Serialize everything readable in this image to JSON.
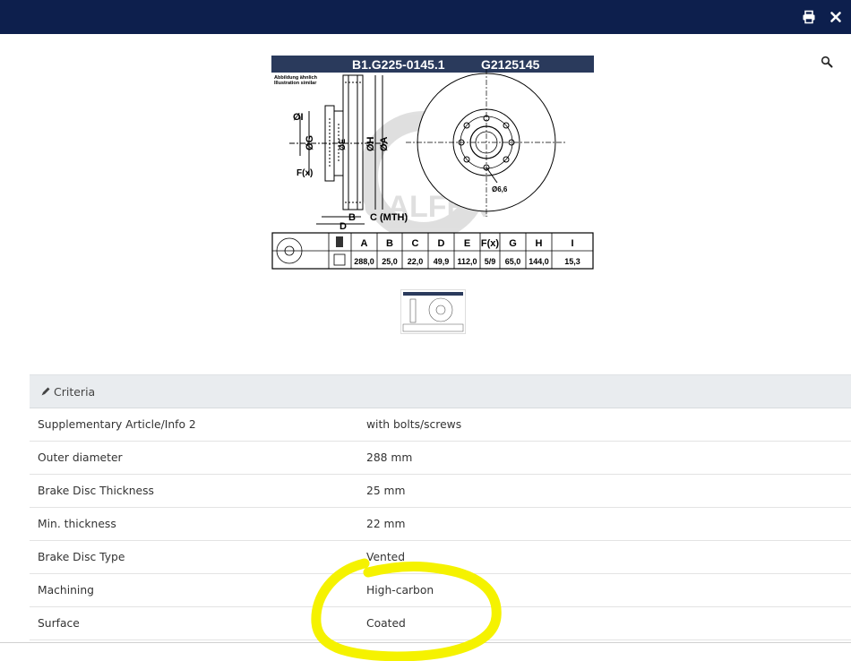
{
  "header": {
    "print_icon": "printer-icon",
    "close_icon": "close-icon",
    "accent": "#0d1f4d"
  },
  "zoom_icon": "magnifier-icon",
  "drawing": {
    "title_left": "B1.G225-0145.1",
    "title_right": "G2125145",
    "note_line1": "Abbildung ähnlich",
    "note_line2": "Illustration similar",
    "mth_label": "C (MTH)",
    "bolt_label": "Ø6,6",
    "dim_labels": {
      "I": "ØI",
      "G": "ØG",
      "E": "ØE",
      "H": "ØH",
      "A": "ØA",
      "F": "F(x)",
      "B": "B",
      "D": "D"
    },
    "table": {
      "headers": [
        "A",
        "B",
        "C",
        "D",
        "E",
        "F(x)",
        "G",
        "H",
        "I"
      ],
      "values": [
        "288,0",
        "25,0",
        "22,0",
        "49,9",
        "112,0",
        "5/9",
        "65,0",
        "144,0",
        "15,3"
      ]
    },
    "watermark": "GALFER"
  },
  "criteria": {
    "title": "Criteria",
    "rows": [
      {
        "label": "Supplementary Article/Info 2",
        "value": "with bolts/screws"
      },
      {
        "label": "Outer diameter",
        "value": "288 mm"
      },
      {
        "label": "Brake Disc Thickness",
        "value": "25 mm"
      },
      {
        "label": "Min. thickness",
        "value": "22 mm"
      },
      {
        "label": "Brake Disc Type",
        "value": "Vented"
      },
      {
        "label": "Machining",
        "value": "High-carbon"
      },
      {
        "label": "Surface",
        "value": "Coated"
      }
    ]
  },
  "highlight_color": "#f5f200"
}
